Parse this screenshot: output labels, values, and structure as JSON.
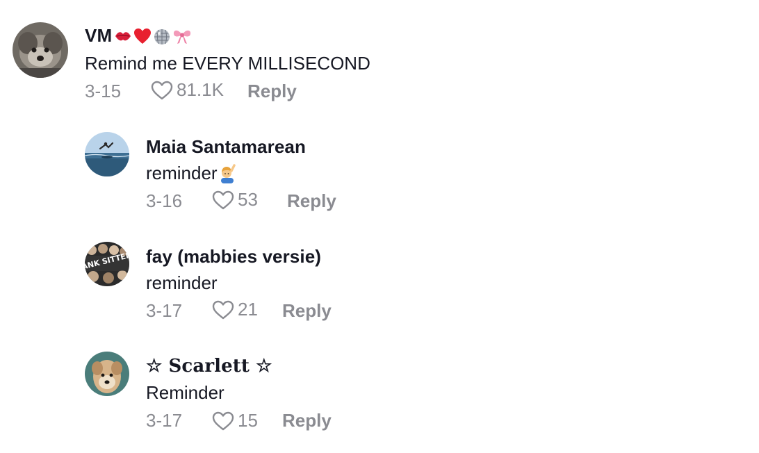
{
  "comments": [
    {
      "username": "VM",
      "text": "Remind me EVERY MILLISECOND",
      "date": "3-15",
      "likes": "81.1K",
      "reply_label": "Reply",
      "username_emojis": [
        "kiss-lips",
        "red-heart",
        "disco-ball",
        "pink-ribbon"
      ]
    },
    {
      "username": "Maia Santamarean",
      "text": "reminder",
      "text_emoji": "person-raising-hand",
      "date": "3-16",
      "likes": "53",
      "reply_label": "Reply"
    },
    {
      "username": "fay (mabbies versie)",
      "text": "reminder",
      "date": "3-17",
      "likes": "21",
      "reply_label": "Reply",
      "avatar_text": "BANK SITTERS"
    },
    {
      "username": "☆ Scarlett ☆",
      "text": "Reminder",
      "date": "3-17",
      "likes": "15",
      "reply_label": "Reply"
    }
  ],
  "colors": {
    "primary_text": "#161823",
    "secondary_text": "#8a8b91"
  }
}
